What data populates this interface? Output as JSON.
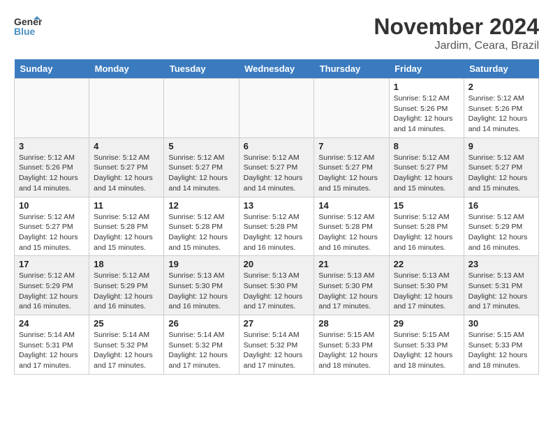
{
  "header": {
    "logo_line1": "General",
    "logo_line2": "Blue",
    "month_title": "November 2024",
    "location": "Jardim, Ceara, Brazil"
  },
  "days_of_week": [
    "Sunday",
    "Monday",
    "Tuesday",
    "Wednesday",
    "Thursday",
    "Friday",
    "Saturday"
  ],
  "weeks": [
    [
      {
        "day": "",
        "info": ""
      },
      {
        "day": "",
        "info": ""
      },
      {
        "day": "",
        "info": ""
      },
      {
        "day": "",
        "info": ""
      },
      {
        "day": "",
        "info": ""
      },
      {
        "day": "1",
        "info": "Sunrise: 5:12 AM\nSunset: 5:26 PM\nDaylight: 12 hours and 14 minutes."
      },
      {
        "day": "2",
        "info": "Sunrise: 5:12 AM\nSunset: 5:26 PM\nDaylight: 12 hours and 14 minutes."
      }
    ],
    [
      {
        "day": "3",
        "info": "Sunrise: 5:12 AM\nSunset: 5:26 PM\nDaylight: 12 hours and 14 minutes."
      },
      {
        "day": "4",
        "info": "Sunrise: 5:12 AM\nSunset: 5:27 PM\nDaylight: 12 hours and 14 minutes."
      },
      {
        "day": "5",
        "info": "Sunrise: 5:12 AM\nSunset: 5:27 PM\nDaylight: 12 hours and 14 minutes."
      },
      {
        "day": "6",
        "info": "Sunrise: 5:12 AM\nSunset: 5:27 PM\nDaylight: 12 hours and 14 minutes."
      },
      {
        "day": "7",
        "info": "Sunrise: 5:12 AM\nSunset: 5:27 PM\nDaylight: 12 hours and 15 minutes."
      },
      {
        "day": "8",
        "info": "Sunrise: 5:12 AM\nSunset: 5:27 PM\nDaylight: 12 hours and 15 minutes."
      },
      {
        "day": "9",
        "info": "Sunrise: 5:12 AM\nSunset: 5:27 PM\nDaylight: 12 hours and 15 minutes."
      }
    ],
    [
      {
        "day": "10",
        "info": "Sunrise: 5:12 AM\nSunset: 5:27 PM\nDaylight: 12 hours and 15 minutes."
      },
      {
        "day": "11",
        "info": "Sunrise: 5:12 AM\nSunset: 5:28 PM\nDaylight: 12 hours and 15 minutes."
      },
      {
        "day": "12",
        "info": "Sunrise: 5:12 AM\nSunset: 5:28 PM\nDaylight: 12 hours and 15 minutes."
      },
      {
        "day": "13",
        "info": "Sunrise: 5:12 AM\nSunset: 5:28 PM\nDaylight: 12 hours and 16 minutes."
      },
      {
        "day": "14",
        "info": "Sunrise: 5:12 AM\nSunset: 5:28 PM\nDaylight: 12 hours and 16 minutes."
      },
      {
        "day": "15",
        "info": "Sunrise: 5:12 AM\nSunset: 5:28 PM\nDaylight: 12 hours and 16 minutes."
      },
      {
        "day": "16",
        "info": "Sunrise: 5:12 AM\nSunset: 5:29 PM\nDaylight: 12 hours and 16 minutes."
      }
    ],
    [
      {
        "day": "17",
        "info": "Sunrise: 5:12 AM\nSunset: 5:29 PM\nDaylight: 12 hours and 16 minutes."
      },
      {
        "day": "18",
        "info": "Sunrise: 5:12 AM\nSunset: 5:29 PM\nDaylight: 12 hours and 16 minutes."
      },
      {
        "day": "19",
        "info": "Sunrise: 5:13 AM\nSunset: 5:30 PM\nDaylight: 12 hours and 16 minutes."
      },
      {
        "day": "20",
        "info": "Sunrise: 5:13 AM\nSunset: 5:30 PM\nDaylight: 12 hours and 17 minutes."
      },
      {
        "day": "21",
        "info": "Sunrise: 5:13 AM\nSunset: 5:30 PM\nDaylight: 12 hours and 17 minutes."
      },
      {
        "day": "22",
        "info": "Sunrise: 5:13 AM\nSunset: 5:30 PM\nDaylight: 12 hours and 17 minutes."
      },
      {
        "day": "23",
        "info": "Sunrise: 5:13 AM\nSunset: 5:31 PM\nDaylight: 12 hours and 17 minutes."
      }
    ],
    [
      {
        "day": "24",
        "info": "Sunrise: 5:14 AM\nSunset: 5:31 PM\nDaylight: 12 hours and 17 minutes."
      },
      {
        "day": "25",
        "info": "Sunrise: 5:14 AM\nSunset: 5:32 PM\nDaylight: 12 hours and 17 minutes."
      },
      {
        "day": "26",
        "info": "Sunrise: 5:14 AM\nSunset: 5:32 PM\nDaylight: 12 hours and 17 minutes."
      },
      {
        "day": "27",
        "info": "Sunrise: 5:14 AM\nSunset: 5:32 PM\nDaylight: 12 hours and 17 minutes."
      },
      {
        "day": "28",
        "info": "Sunrise: 5:15 AM\nSunset: 5:33 PM\nDaylight: 12 hours and 18 minutes."
      },
      {
        "day": "29",
        "info": "Sunrise: 5:15 AM\nSunset: 5:33 PM\nDaylight: 12 hours and 18 minutes."
      },
      {
        "day": "30",
        "info": "Sunrise: 5:15 AM\nSunset: 5:33 PM\nDaylight: 12 hours and 18 minutes."
      }
    ]
  ]
}
